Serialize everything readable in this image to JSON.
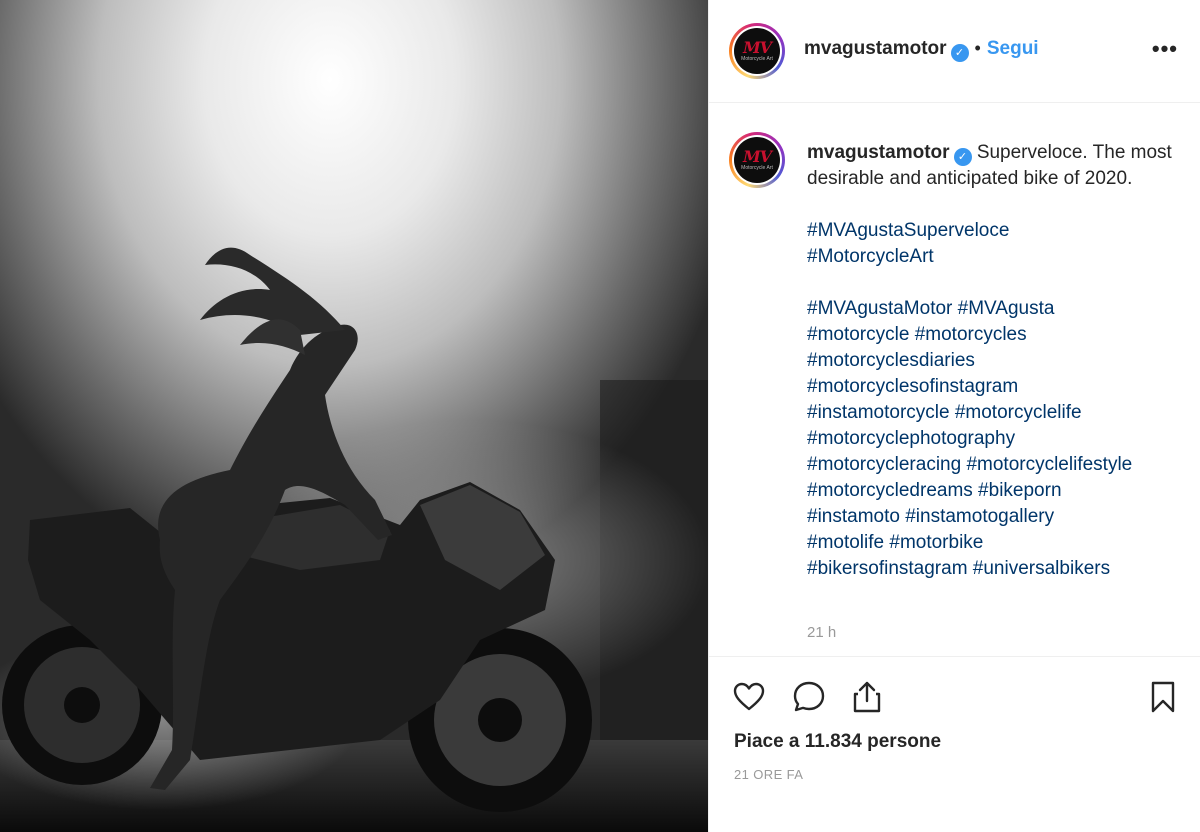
{
  "post": {
    "image_alt": "",
    "author": {
      "username": "mvagustamotor",
      "verified": true,
      "avatar_logo_text": "MV",
      "avatar_logo_sub": "Motorcycle Art"
    },
    "header": {
      "separator": "•",
      "follow_label": "Segui",
      "more_label": "•••"
    },
    "caption": {
      "username": "mvagustamotor",
      "text": "Superveloce. The most desirable and anticipated bike of 2020.",
      "hashtag_groups": [
        [
          "#MVAgustaSuperveloce",
          "#MotorcycleArt"
        ],
        [
          "#MVAgustaMotor #MVAgusta",
          "#motorcycle #motorcycles",
          "#motorcyclesdiaries",
          "#motorcyclesofinstagram",
          "#instamotorcycle #motorcyclelife",
          "#motorcyclephotography",
          "#motorcycleracing #motorcyclelifestyle",
          "#motorcycledreams #bikeporn",
          "#instamoto #instamotogallery",
          "#motolife #motorbike",
          "#bikersofinstagram #universalbikers"
        ]
      ],
      "time": "21 h"
    },
    "actions": {
      "like_icon": "heart-icon",
      "comment_icon": "comment-icon",
      "share_icon": "share-icon",
      "save_icon": "bookmark-icon"
    },
    "likes_text": "Piace a 11.834 persone",
    "posted_ago": "21 ORE FA"
  },
  "colors": {
    "link": "#003569",
    "follow": "#3897f0",
    "verified": "#3897f0",
    "muted": "#999999",
    "brand_red": "#c8102e"
  }
}
